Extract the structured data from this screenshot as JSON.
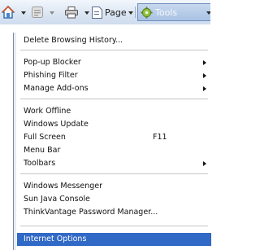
{
  "toolbar": {
    "page_label": "Page",
    "tools_label": "Tools"
  },
  "menu": {
    "items": [
      {
        "label": "Delete Browsing History..."
      },
      {
        "label": "Pop-up Blocker",
        "submenu": true
      },
      {
        "label": "Phishing Filter",
        "submenu": true
      },
      {
        "label": "Manage Add-ons",
        "submenu": true
      },
      {
        "label": "Work Offline"
      },
      {
        "label": "Windows Update"
      },
      {
        "label": "Full Screen",
        "shortcut": "F11"
      },
      {
        "label": "Menu Bar"
      },
      {
        "label": "Toolbars",
        "submenu": true
      },
      {
        "label": "Windows Messenger"
      },
      {
        "label": "Sun Java Console"
      },
      {
        "label": "ThinkVantage Password Manager..."
      },
      {
        "label": "Internet Options",
        "highlighted": true
      }
    ]
  },
  "colors": {
    "highlight": "#3169c6",
    "toolbar_top": "#f2f6fc",
    "toolbar_bottom": "#cfdcee"
  }
}
